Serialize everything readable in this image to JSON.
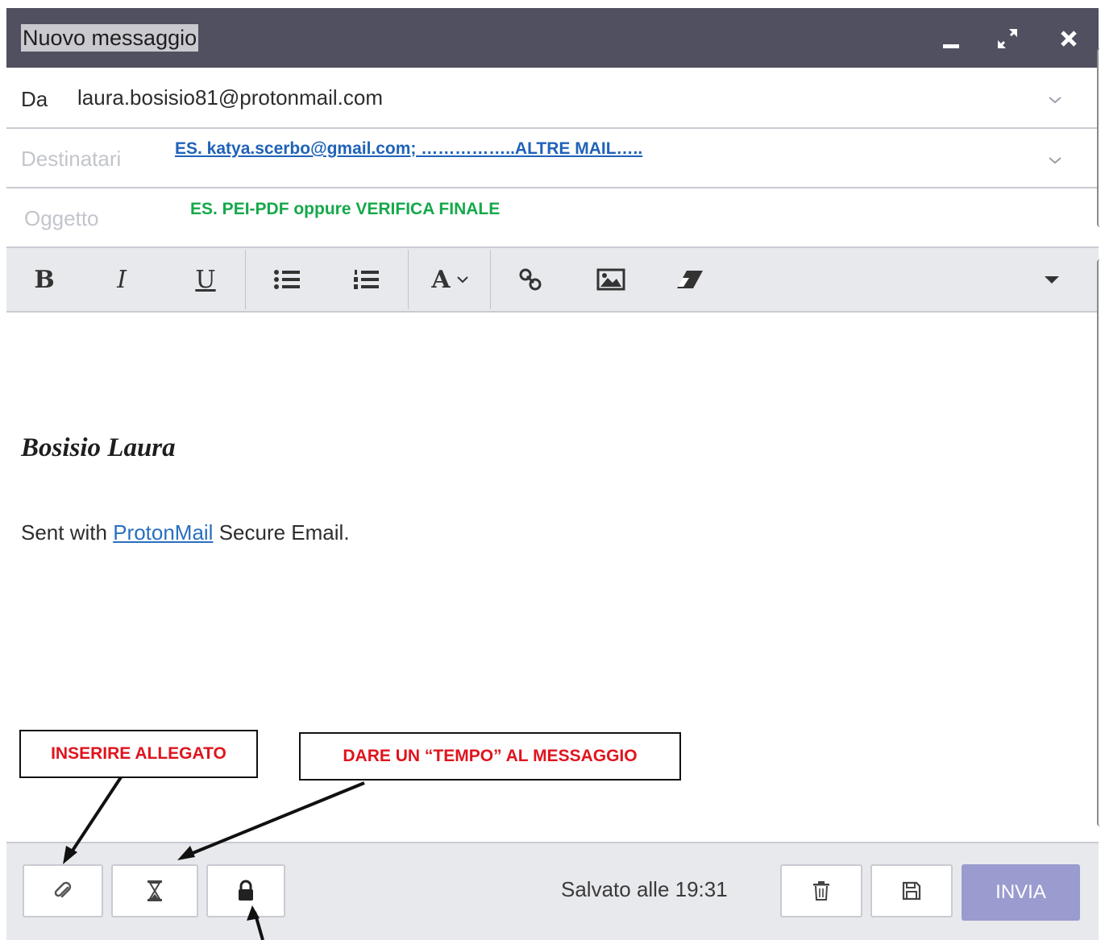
{
  "window": {
    "title": "Nuovo messaggio"
  },
  "from": {
    "label": "Da",
    "value": "laura.bosisio81@protonmail.com"
  },
  "recipients": {
    "placeholder": "Destinatari",
    "annotation": "ES. katya.scerbo@gmail.com; ……………..ALTRE MAIL….."
  },
  "subject": {
    "placeholder": "Oggetto",
    "annotation": "ES. PEI-PDF oppure VERIFICA FINALE"
  },
  "toolbar": {
    "bold": "B",
    "italic": "I",
    "underline": "U",
    "font": "A"
  },
  "body": {
    "signature": "Bosisio Laura",
    "sent_prefix": "Sent with",
    "sent_link": "ProtonMail",
    "sent_suffix": "Secure Email."
  },
  "callouts": {
    "attach": "INSERIRE ALLEGATO",
    "timer": "DARE UN “TEMPO” AL MESSAGGIO"
  },
  "footer": {
    "saved": "Salvato alle 19:31",
    "send": "INVIA"
  },
  "colors": {
    "titlebar": "#505061",
    "send_button": "#9a9ccf",
    "annotation_blue": "#1f62b8",
    "annotation_green": "#15a84a",
    "callout_red": "#e0141e"
  },
  "icons": [
    "minimize-icon",
    "expand-icon",
    "close-icon",
    "chevron-down-icon",
    "bullet-list-icon",
    "numbered-list-icon",
    "link-icon",
    "image-icon",
    "eraser-icon",
    "caret-down-icon",
    "paperclip-icon",
    "hourglass-icon",
    "lock-icon",
    "trash-icon",
    "floppy-disk-icon"
  ]
}
